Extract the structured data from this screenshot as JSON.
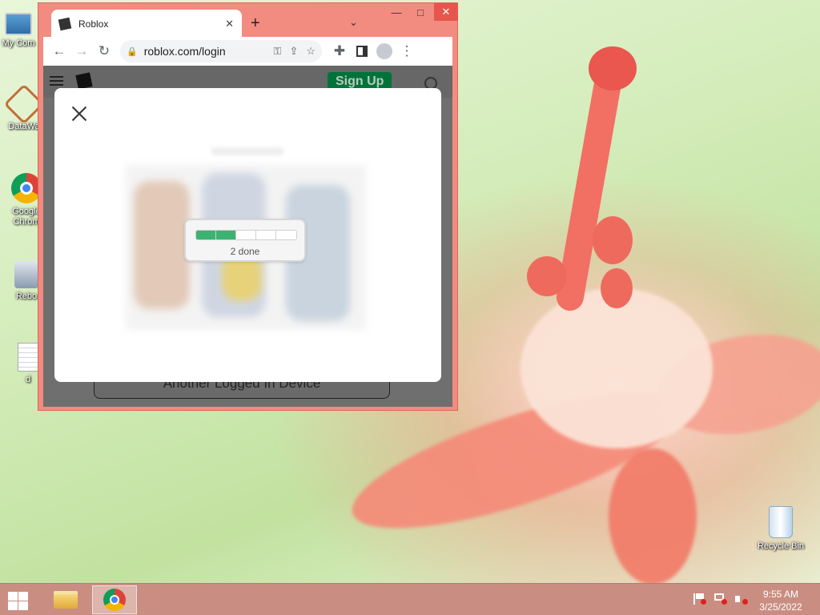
{
  "desktop": {
    "icons": [
      {
        "label": "My Com"
      },
      {
        "label": "DataWa"
      },
      {
        "label": "Goog­le Chrom"
      },
      {
        "label": "Rebo"
      },
      {
        "label": "d"
      },
      {
        "label": "Recycle Bin"
      }
    ]
  },
  "browser": {
    "tab_title": "Roblox",
    "new_tab_label": "+",
    "url": "roblox.com/login",
    "window_controls": {
      "minimize": "—",
      "maximize": "□",
      "close": "✕"
    }
  },
  "page": {
    "signup_label": "Sign Up",
    "another_device_label": "Another Logged In Device"
  },
  "modal": {
    "progress": {
      "segments_total": 5,
      "segments_done": 2,
      "label": "2 done"
    }
  },
  "taskbar": {
    "time": "9:55 AM",
    "date": "3/25/2022"
  },
  "colors": {
    "window_frame": "#f28b80",
    "progress_fill": "#3cb371",
    "signup_green": "#00733a",
    "taskbar": "#c98e81"
  }
}
